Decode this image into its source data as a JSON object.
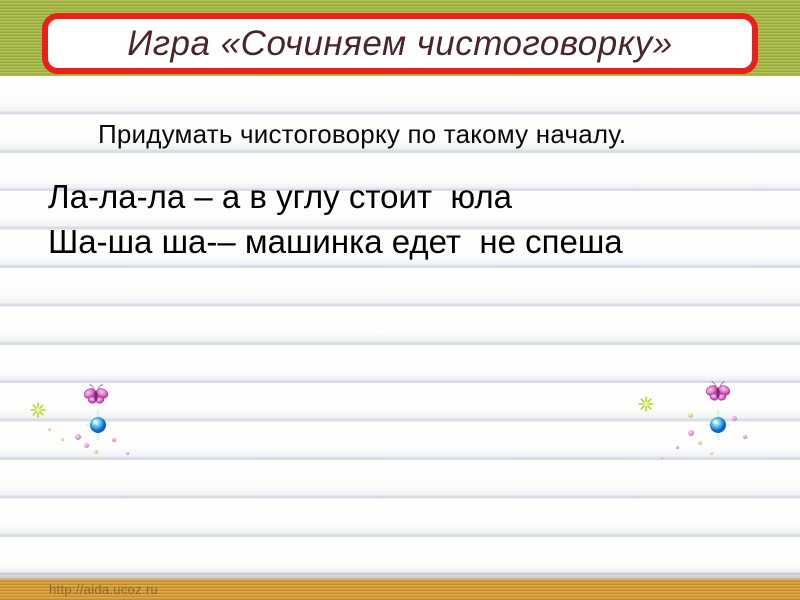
{
  "slide": {
    "title": "Игра «Сочиняем чистоговорку»",
    "subtitle": "Придумать чистоговорку по такому началу.",
    "body_lines": {
      "line1": "Ла-ла-ла – а в углу стоит  юла",
      "line2": "Ша-ша ша-– машинка едет  не спеша"
    },
    "watermark": "http://aida.ucoz.ru"
  },
  "decorations": {
    "left_cluster": [
      "butterfly",
      "blue-orb",
      "green-sparkle",
      "sparkle-dots"
    ],
    "right_cluster": [
      "butterfly",
      "blue-orb",
      "green-sparkle",
      "sparkle-dots"
    ]
  },
  "colors": {
    "top_band_green": "#a9ba4f",
    "top_band_stripe": "#99aa3d",
    "title_border_red": "#e8211d",
    "title_text_maroon": "#4b2527",
    "body_text": "#000000",
    "ruled_line": "#d7dce2",
    "bottom_band_orange": "#d9a143",
    "bottom_band_stripe": "#c48c2c",
    "watermark_brown": "#7a5c28",
    "butterfly_pink": "#d95fc0",
    "orb_blue": "#2b8fe0",
    "sparkle_green": "#c6dc3c"
  }
}
